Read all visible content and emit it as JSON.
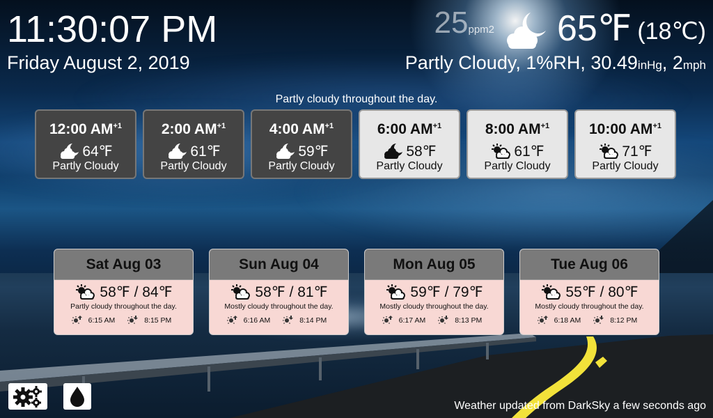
{
  "clock": {
    "time": "11:30:07 PM",
    "date": "Friday August 2, 2019"
  },
  "current": {
    "aqi_value": "25",
    "aqi_unit": "ppm2",
    "icon": "partly-cloudy-night-icon",
    "temp_f": "65℉",
    "temp_c": "(18℃)",
    "condition": "Partly Cloudy, 1%RH, 30.49",
    "pressure_unit": "inHg",
    "wind_prefix": ", 2",
    "wind_unit": "mph"
  },
  "hourly_summary": "Partly cloudy throughout the day.",
  "hourly": [
    {
      "time": "12:00 AM",
      "sup": "+1",
      "icon": "partly-cloudy-night-icon",
      "temp": "64℉",
      "summary": "Partly Cloudy",
      "style": "dark"
    },
    {
      "time": "2:00 AM",
      "sup": "+1",
      "icon": "partly-cloudy-night-icon",
      "temp": "61℉",
      "summary": "Partly Cloudy",
      "style": "dark"
    },
    {
      "time": "4:00 AM",
      "sup": "+1",
      "icon": "partly-cloudy-night-icon",
      "temp": "59℉",
      "summary": "Partly Cloudy",
      "style": "dark"
    },
    {
      "time": "6:00 AM",
      "sup": "+1",
      "icon": "partly-cloudy-night-icon",
      "temp": "58℉",
      "summary": "Partly Cloudy",
      "style": "light"
    },
    {
      "time": "8:00 AM",
      "sup": "+1",
      "icon": "partly-cloudy-day-icon",
      "temp": "61℉",
      "summary": "Partly Cloudy",
      "style": "light"
    },
    {
      "time": "10:00 AM",
      "sup": "+1",
      "icon": "partly-cloudy-day-icon",
      "temp": "71℉",
      "summary": "Partly Cloudy",
      "style": "light"
    }
  ],
  "daily": [
    {
      "day": "Sat Aug 03",
      "icon": "partly-cloudy-day-icon",
      "temps": "58℉ / 84℉",
      "summary": "Partly cloudy throughout the day.",
      "sunrise": "6:15 AM",
      "sunset": "8:15 PM"
    },
    {
      "day": "Sun Aug 04",
      "icon": "partly-cloudy-day-icon",
      "temps": "58℉ / 81℉",
      "summary": "Mostly cloudy throughout the day.",
      "sunrise": "6:16 AM",
      "sunset": "8:14 PM"
    },
    {
      "day": "Mon Aug 05",
      "icon": "partly-cloudy-day-icon",
      "temps": "59℉ / 79℉",
      "summary": "Mostly cloudy throughout the day.",
      "sunrise": "6:17 AM",
      "sunset": "8:13 PM"
    },
    {
      "day": "Tue Aug 06",
      "icon": "partly-cloudy-day-icon",
      "temps": "55℉ / 80℉",
      "summary": "Mostly cloudy throughout the day.",
      "sunrise": "6:18 AM",
      "sunset": "8:12 PM"
    }
  ],
  "buttons": {
    "settings_icon": "gears-icon",
    "drop_icon": "water-drop-icon"
  },
  "footer": {
    "updated": "Weather updated from DarkSky a few seconds ago"
  }
}
